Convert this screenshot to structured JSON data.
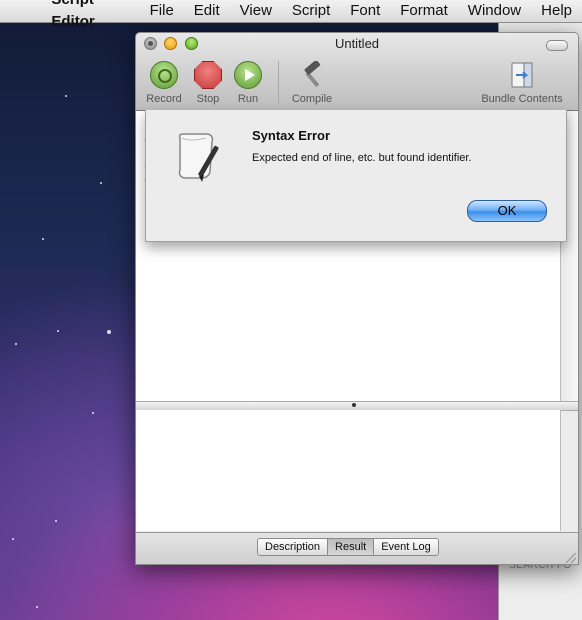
{
  "menubar": {
    "app_name": "Script Editor",
    "items": [
      "File",
      "Edit",
      "View",
      "Script",
      "Font",
      "Format",
      "Window",
      "Help"
    ]
  },
  "window": {
    "title": "Untitled",
    "toolbar": {
      "record": "Record",
      "stop": "Stop",
      "run": "Run",
      "compile": "Compile",
      "bundle_contents": "Bundle Contents"
    },
    "tabs": [
      "Description",
      "Result",
      "Event Log"
    ],
    "active_tab": "Result"
  },
  "dialog": {
    "title": "Syntax Error",
    "message": "Expected end of line, etc. but found identifier.",
    "ok_label": "OK"
  },
  "background_window": {
    "search_label": "SEARCH FO"
  },
  "colors": {
    "ok_button": "#3d8ee8",
    "menubar": "#e6e6e6"
  }
}
